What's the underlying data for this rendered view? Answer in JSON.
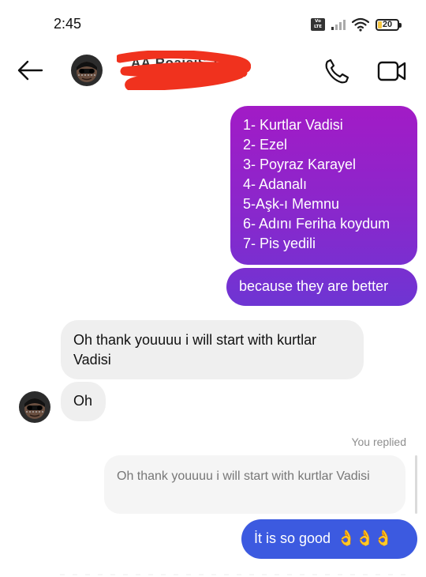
{
  "status_bar": {
    "time": "2:45",
    "network_badge": [
      "Vo",
      "LTE"
    ],
    "battery_level": "20"
  },
  "header": {
    "contact_name": "ÀÀ RoaisiS TrØ",
    "back_icon": "arrow-left-icon",
    "call_icon": "phone-icon",
    "video_icon": "video-camera-icon"
  },
  "messages": {
    "sent_list": [
      "1- Kurtlar Vadisi",
      "2- Ezel",
      "3- Poyraz Karayel",
      "4- Adanalı",
      "5-Aşk-ı Memnu",
      "6- Adını Feriha koydum",
      "7- Pis yedili"
    ],
    "sent_better": "because they are better",
    "received_1": "Oh thank youuuu i will start with kurtlar Vadisi",
    "received_2": "Oh",
    "reply_meta": "You replied",
    "quoted_text": "Oh thank youuuu i will start with kurtlar Vadisi",
    "sent_good": "İt is so good",
    "sent_good_emoji": "👌👌👌"
  },
  "colors": {
    "sent_gradient_top": "#a21bc6",
    "sent_gradient_bottom": "#6e35d3",
    "sent_blue": "#3c5ae0",
    "received_bg": "#efefef",
    "redaction": "#f0321e"
  }
}
